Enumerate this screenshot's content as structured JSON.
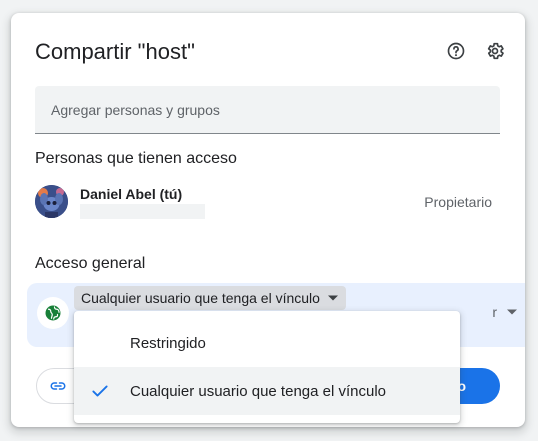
{
  "dialog": {
    "title": "Compartir \"host\"",
    "icons": {
      "help": "help-circle-icon",
      "settings": "gear-icon"
    }
  },
  "add_people": {
    "placeholder": "Agregar personas y grupos",
    "value": ""
  },
  "people_section": {
    "title": "Personas que tienen acceso",
    "people": [
      {
        "name": "Daniel Abel (tú)",
        "email": "",
        "role": "Propietario"
      }
    ]
  },
  "general_section": {
    "title": "Acceso general",
    "access_value": "Cualquier usuario que tenga el vínculo",
    "role_value": "r"
  },
  "footer": {
    "copy_icon": "link-icon",
    "done_label": "sto"
  },
  "access_menu": {
    "items": [
      {
        "label": "Restringido",
        "selected": false
      },
      {
        "label": "Cualquier usuario que tenga el vínculo",
        "selected": true
      }
    ]
  },
  "colors": {
    "accent": "#1a73e8",
    "selected_row": "#e8f0fe",
    "globe": "#188038"
  }
}
